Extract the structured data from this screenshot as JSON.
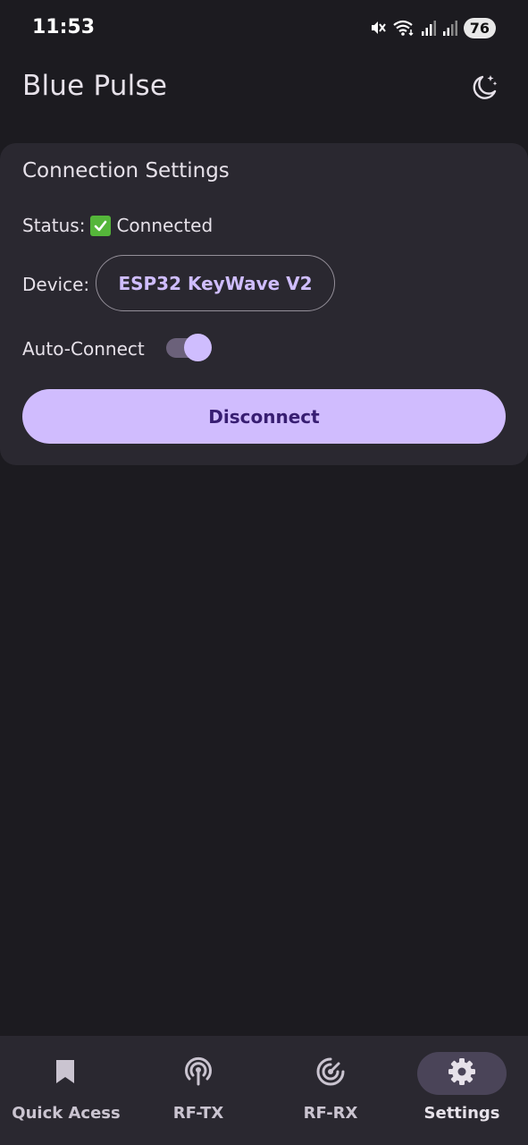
{
  "status_bar": {
    "time": "11:53",
    "battery": "76",
    "icons": [
      "mute-icon",
      "wifi-icon",
      "signal-icon",
      "signal-icon"
    ]
  },
  "app_bar": {
    "title": "Blue Pulse",
    "theme_icon": "moon-stars-icon"
  },
  "connection_card": {
    "title": "Connection Settings",
    "status_label": "Status:",
    "status_value": "Connected",
    "status_icon": "check-box-icon",
    "device_label": "Device:",
    "device_name": "ESP32 KeyWave V2",
    "auto_connect_label": "Auto-Connect",
    "auto_connect_on": true,
    "disconnect_label": "Disconnect"
  },
  "bottom_nav": {
    "items": [
      {
        "label": "Quick Acess",
        "icon": "bookmark-icon",
        "active": false
      },
      {
        "label": "RF-TX",
        "icon": "broadcast-icon",
        "active": false
      },
      {
        "label": "RF-RX",
        "icon": "receiver-icon",
        "active": false
      },
      {
        "label": "Settings",
        "icon": "gear-icon",
        "active": true
      }
    ]
  },
  "colors": {
    "background": "#1c1b20",
    "surface": "#2a2830",
    "primary": "#d0bcfe",
    "on_primary": "#381e72",
    "outline": "#948f99",
    "active_indicator": "#4a4458"
  }
}
